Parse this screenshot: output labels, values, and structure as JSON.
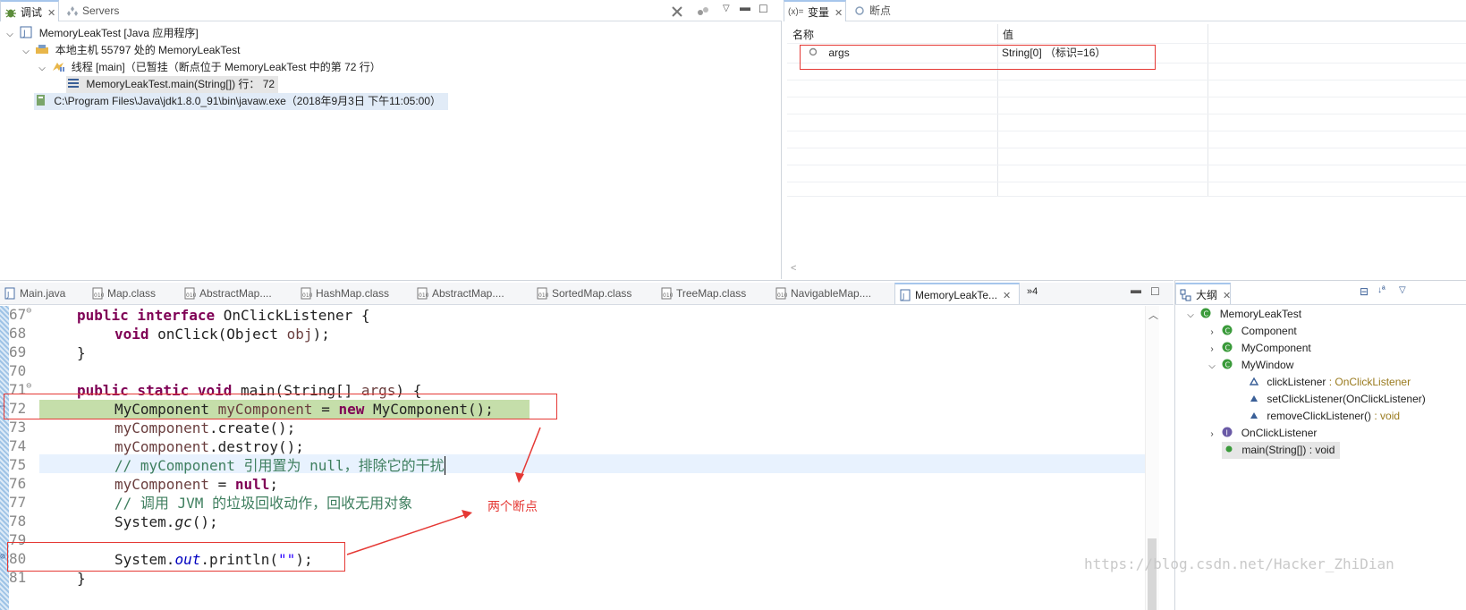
{
  "debug_view": {
    "tabs": [
      {
        "label": "调试"
      },
      {
        "label": "Servers"
      }
    ],
    "tree": [
      {
        "label": "MemoryLeakTest [Java 应用程序]"
      },
      {
        "label": "本地主机 55797 处的 MemoryLeakTest"
      },
      {
        "label": "线程 [main]（已暂挂（断点位于 MemoryLeakTest 中的第 72 行）"
      },
      {
        "label": "MemoryLeakTest.main(String[]) 行： 72"
      },
      {
        "label": "C:\\Program Files\\Java\\jdk1.8.0_91\\bin\\javaw.exe（2018年9月3日 下午11:05:00）"
      }
    ]
  },
  "variables_view": {
    "tabs": [
      {
        "label": "变量"
      },
      {
        "label": "断点"
      }
    ],
    "columns": {
      "name": "名称",
      "value": "值"
    },
    "rows": [
      {
        "name": "args",
        "value": "String[0]  （标识=16）"
      }
    ]
  },
  "editor": {
    "tabs": [
      {
        "label": "Main.java"
      },
      {
        "label": "Map.class"
      },
      {
        "label": "AbstractMap...."
      },
      {
        "label": "HashMap.class"
      },
      {
        "label": "AbstractMap...."
      },
      {
        "label": "SortedMap.class"
      },
      {
        "label": "TreeMap.class"
      },
      {
        "label": "NavigableMap...."
      },
      {
        "label": "MemoryLeakTe..."
      },
      {
        "label": "»4"
      }
    ],
    "lines": [
      {
        "num": "67",
        "fold": "⊖"
      },
      {
        "num": "68"
      },
      {
        "num": "69"
      },
      {
        "num": "70"
      },
      {
        "num": "71",
        "fold": "⊖"
      },
      {
        "num": "72"
      },
      {
        "num": "73"
      },
      {
        "num": "74"
      },
      {
        "num": "75"
      },
      {
        "num": "76"
      },
      {
        "num": "77"
      },
      {
        "num": "78"
      },
      {
        "num": "79"
      },
      {
        "num": "80"
      },
      {
        "num": "81"
      }
    ],
    "code": {
      "l67": {
        "kw1": "public interface",
        "rest": " OnClickListener {"
      },
      "l68": {
        "kw1": "void",
        "rest": " onClick(Object ",
        "var": "obj",
        "end": ");"
      },
      "l69": {
        "text": "}"
      },
      "l71": {
        "kw1": "public static void",
        "rest": " main(String[] ",
        "var": "args",
        "end": ") {"
      },
      "l72": {
        "a": "MyComponent ",
        "var": "myComponent",
        "b": " = ",
        "kw": "new",
        "c": " MyComponent();"
      },
      "l73": {
        "var": "myComponent",
        "rest": ".create();"
      },
      "l74": {
        "var": "myComponent",
        "rest": ".destroy();"
      },
      "l75": {
        "comment": "// myComponent 引用置为 null，排除它的干扰"
      },
      "l76": {
        "var": "myComponent",
        "b": " = ",
        "kw": "null",
        "end": ";"
      },
      "l77": {
        "comment": "// 调用 JVM 的垃圾回收动作，回收无用对象"
      },
      "l78": {
        "a": "System.",
        "it": "gc",
        "end": "();"
      },
      "l80": {
        "a": "System.",
        "fld": "out",
        "b": ".println(",
        "str": "\"\"",
        "end": ");"
      },
      "l81": {
        "text": "}"
      }
    },
    "annotation": "两个断点"
  },
  "outline_view": {
    "tab": "大纲",
    "items": [
      {
        "label": "MemoryLeakTest"
      },
      {
        "label": "Component"
      },
      {
        "label": "MyComponent"
      },
      {
        "label": "MyWindow"
      },
      {
        "label": "clickListener",
        "type": " : OnClickListener"
      },
      {
        "label": "setClickListener(OnClickListener)"
      },
      {
        "label": "removeClickListener()",
        "type": " : void"
      },
      {
        "label": "OnClickListener"
      },
      {
        "label": "main(String[]) : void"
      }
    ]
  },
  "watermark": "https://blog.csdn.net/Hacker_ZhiDian",
  "colors": {
    "current_line_bg": "#c5deaa",
    "annotation_red": "#e53935",
    "selection_bg": "#e1ebf7"
  }
}
